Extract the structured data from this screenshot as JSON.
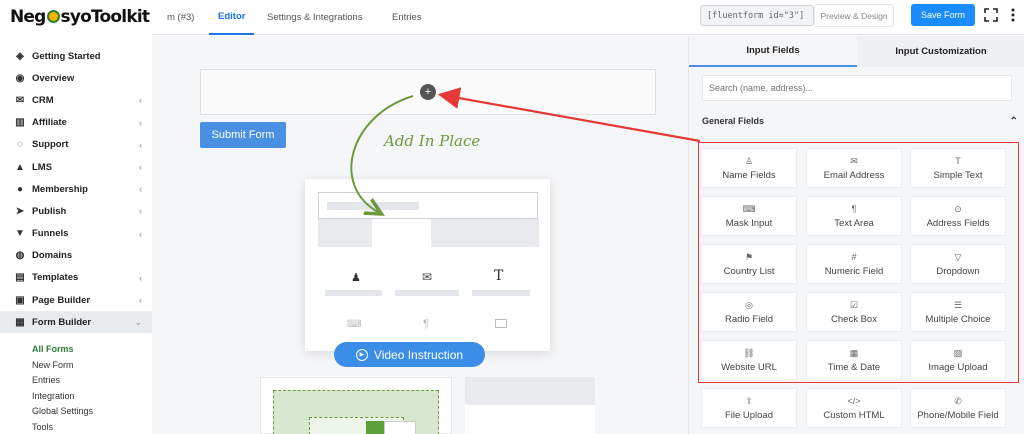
{
  "logo": {
    "before": "Neg",
    "after": "syo",
    "tail": "Toolkit"
  },
  "sidebar": {
    "items": [
      {
        "label": "Getting Started",
        "icon": "layers-icon",
        "glyph": "◈",
        "chevron": false
      },
      {
        "label": "Overview",
        "icon": "eye-icon",
        "glyph": "◉",
        "chevron": false
      },
      {
        "label": "CRM",
        "icon": "mail-icon",
        "glyph": "✉",
        "chevron": true
      },
      {
        "label": "Affiliate",
        "icon": "chart-icon",
        "glyph": "▥",
        "chevron": true
      },
      {
        "label": "Support",
        "icon": "whatsapp-icon",
        "glyph": "◌",
        "chevron": true
      },
      {
        "label": "LMS",
        "icon": "graduation-cap-icon",
        "glyph": "▲",
        "chevron": true
      },
      {
        "label": "Membership",
        "icon": "users-icon",
        "glyph": "●",
        "chevron": true
      },
      {
        "label": "Publish",
        "icon": "send-icon",
        "glyph": "➤",
        "chevron": true
      },
      {
        "label": "Funnels",
        "icon": "filter-icon",
        "glyph": "▼",
        "chevron": true
      },
      {
        "label": "Domains",
        "icon": "globe-icon",
        "glyph": "◍",
        "chevron": false
      },
      {
        "label": "Templates",
        "icon": "document-icon",
        "glyph": "▤",
        "chevron": true
      },
      {
        "label": "Page Builder",
        "icon": "page-icon",
        "glyph": "▣",
        "chevron": true
      },
      {
        "label": "Form Builder",
        "icon": "table-icon",
        "glyph": "▦",
        "chevron": true,
        "active": true
      }
    ],
    "sub_items": [
      "All Forms",
      "New Form",
      "Entries",
      "Integration",
      "Global Settings",
      "Tools"
    ]
  },
  "topbar": {
    "tabs": [
      "m (#3)",
      "Editor",
      "Settings & Integrations",
      "Entries"
    ],
    "shortcode": "[fluentform id=\"3\"]",
    "preview_label": "Preview & Design",
    "save_label": "Save Form"
  },
  "canvas": {
    "submit_label": "Submit Form",
    "add_in_place": "Add In Place",
    "video_label": "Video Instruction"
  },
  "panel": {
    "tabs": [
      "Input Fields",
      "Input Customization"
    ],
    "search_placeholder": "Search (name, address)...",
    "section_title": "General Fields",
    "fields": [
      {
        "label": "Name Fields",
        "glyph": "♙"
      },
      {
        "label": "Email Address",
        "glyph": "✉"
      },
      {
        "label": "Simple Text",
        "glyph": "T"
      },
      {
        "label": "Mask Input",
        "glyph": "⌨"
      },
      {
        "label": "Text Area",
        "glyph": "¶"
      },
      {
        "label": "Address Fields",
        "glyph": "⊙"
      },
      {
        "label": "Country List",
        "glyph": "⚑"
      },
      {
        "label": "Numeric Field",
        "glyph": "#"
      },
      {
        "label": "Dropdown",
        "glyph": "▽"
      },
      {
        "label": "Radio Field",
        "glyph": "◎"
      },
      {
        "label": "Check Box",
        "glyph": "☑"
      },
      {
        "label": "Multiple Choice",
        "glyph": "☰"
      },
      {
        "label": "Website URL",
        "glyph": "⛓"
      },
      {
        "label": "Time & Date",
        "glyph": "▦"
      },
      {
        "label": "Image Upload",
        "glyph": "▨"
      },
      {
        "label": "File Upload",
        "glyph": "⇪"
      },
      {
        "label": "Custom HTML",
        "glyph": "</>"
      },
      {
        "label": "Phone/Mobile Field",
        "glyph": "✆"
      }
    ]
  },
  "colors": {
    "accent": "#1a8cff",
    "annotation_red": "#e53935",
    "annotation_green": "#6a9a3b",
    "active_green": "#2e7d32"
  }
}
